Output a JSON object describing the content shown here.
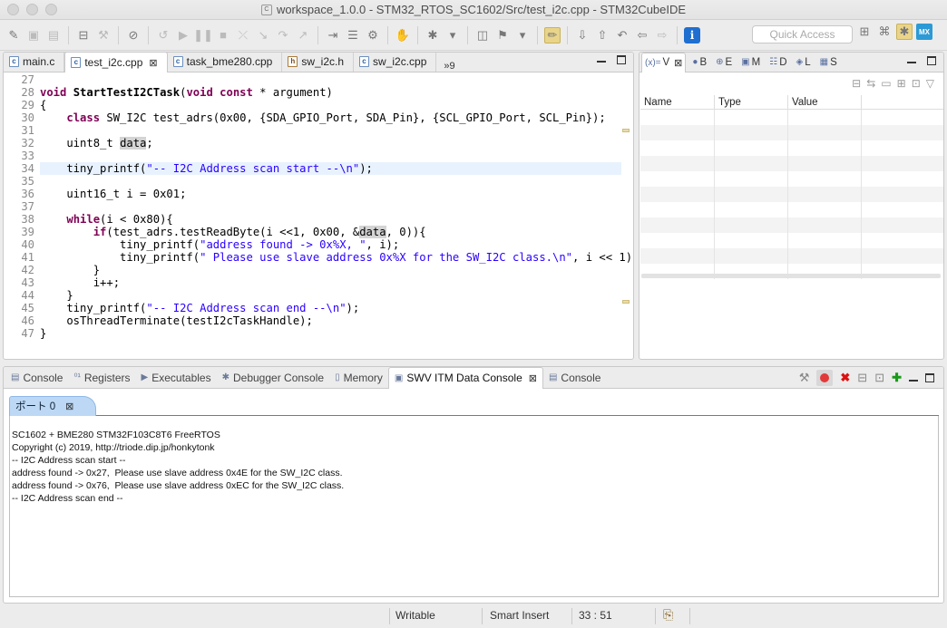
{
  "window": {
    "title": "workspace_1.0.0 - STM32_RTOS_SC1602/Src/test_i2c.cpp - STM32CubeIDE",
    "title_icon": "C"
  },
  "toolbar": {
    "quick_access_placeholder": "Quick Access"
  },
  "editor": {
    "tabs": [
      {
        "label": "main.c",
        "icon": "c-file-icon",
        "active": false
      },
      {
        "label": "test_i2c.cpp",
        "icon": "c-file-icon",
        "active": true
      },
      {
        "label": "task_bme280.cpp",
        "icon": "c-file-icon",
        "active": false
      },
      {
        "label": "sw_i2c.h",
        "icon": "h-file-icon",
        "active": false
      },
      {
        "label": "sw_i2c.cpp",
        "icon": "c-file-icon",
        "active": false
      }
    ],
    "overflow_label": "»9",
    "line_numbers": [
      "27",
      "28",
      "29",
      "30",
      "31",
      "32",
      "33",
      "34",
      "35",
      "36",
      "37",
      "38",
      "39",
      "40",
      "41",
      "42",
      "43",
      "44",
      "45",
      "46",
      "47"
    ],
    "current_line": "33"
  },
  "variables": {
    "tabs": [
      {
        "icon": "(x)=",
        "label": "V"
      },
      {
        "icon": "breakpoint-icon",
        "label": "B"
      },
      {
        "icon": "expressions-icon",
        "label": "E"
      },
      {
        "icon": "modules-icon",
        "label": "M"
      },
      {
        "icon": "disassembly-icon",
        "label": "D"
      },
      {
        "icon": "live-expr-icon",
        "label": "L"
      },
      {
        "icon": "sfr-icon",
        "label": "S"
      }
    ],
    "columns": [
      "Name",
      "Type",
      "Value"
    ]
  },
  "bottom": {
    "tabs": [
      {
        "label": "Console",
        "active": false
      },
      {
        "label": "Registers",
        "active": false
      },
      {
        "label": "Executables",
        "active": false
      },
      {
        "label": "Debugger Console",
        "active": false
      },
      {
        "label": "Memory",
        "active": false
      },
      {
        "label": "SWV ITM Data Console",
        "active": true
      },
      {
        "label": "Console",
        "active": false
      }
    ],
    "port_tab": "ポート 0",
    "console_lines": [
      "SC1602 + BME280 STM32F103C8T6 FreeRTOS",
      "Copyright (c) 2019, http://triode.dip.jp/honkytonk",
      "-- I2C Address scan start --",
      "address found -> 0x27,  Please use slave address 0x4E for the SW_I2C class.",
      "address found -> 0x76,  Please use slave address 0xEC for the SW_I2C class.",
      "-- I2C Address scan end --"
    ]
  },
  "status": {
    "writable": "Writable",
    "insert_mode": "Smart Insert",
    "position": "33 : 51"
  }
}
